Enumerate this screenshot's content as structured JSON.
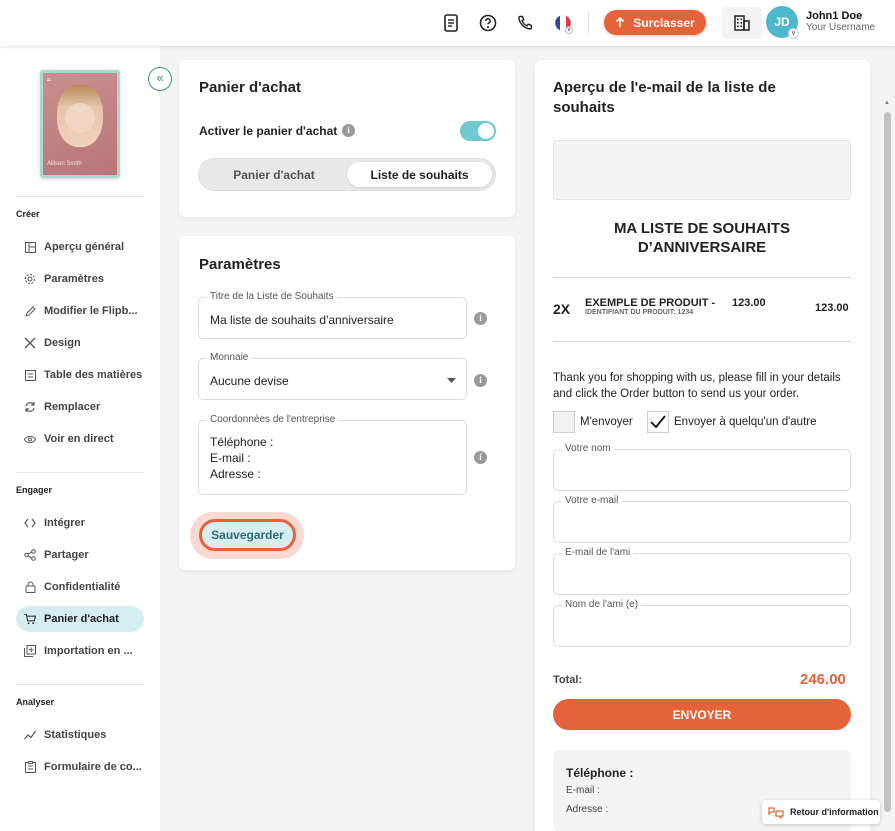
{
  "topbar": {
    "upgrade_label": "Surclasser",
    "avatar_initials": "JD",
    "user_name": "John1 Doe",
    "user_sub": "Your Username"
  },
  "sidebar": {
    "sections": {
      "create": "Créer",
      "engage": "Engager",
      "analyze": "Analyser"
    },
    "create_items": [
      "Aperçu général",
      "Paramètres",
      "Modifier le Flipb...",
      "Design",
      "Table des matières",
      "Remplacer",
      "Voir en direct"
    ],
    "engage_items": [
      "Intégrer",
      "Partager",
      "Confidentialité",
      "Panier d'achat",
      "Importation en ..."
    ],
    "analyze_items": [
      "Statistiques",
      "Formulaire de co..."
    ],
    "cover_text": "Allison Smith"
  },
  "cart_card": {
    "title": "Panier d'achat",
    "enable_label": "Activer le panier d'achat",
    "toggle_on": true,
    "seg_cart": "Panier d'achat",
    "seg_wishlist": "Liste de souhaits"
  },
  "params_card": {
    "title": "Paramètres",
    "wishlist_title_label": "Titre de la Liste de Souhaits",
    "wishlist_title_value": "Ma liste de souhaits d'anniversaire",
    "currency_label": "Monnaie",
    "currency_value": "Aucune devise",
    "company_label": "Coordonnées de l'entreprise",
    "company_lines": [
      "Téléphone :",
      "E-mail :",
      "Adresse :"
    ],
    "save_label": "Sauvegarder"
  },
  "preview": {
    "title": "Aperçu de l'e-mail de la liste de souhaits",
    "wishlist_heading": "MA LISTE DE SOUHAITS D’ANNIVERSAIRE",
    "qty": "2X",
    "product_name": "EXEMPLE DE PRODUIT -",
    "product_price": "123.00",
    "product_id": "IDENTIFIANT DU PRODUIT: 1234",
    "line_total": "123.00",
    "thanks": "Thank you for shopping with us, please fill in your details and click the Order button to send us your order.",
    "send_me": "M'envoyer",
    "send_other": "Envoyer à quelqu'un d'autre",
    "name_label": "Votre nom",
    "email_label": "Votre e-mail",
    "friend_email_label": "E-mail de l'ami",
    "friend_name_label": "Nom de l'ami (e)",
    "total_label": "Total:",
    "total_value": "246.00",
    "send_button": "ENVOYER",
    "contact_phone": "Téléphone :",
    "contact_email": "E-mail :",
    "contact_address": "Adresse :"
  },
  "feedback_label": "Retour d'information",
  "colors": {
    "accent": "#e5623a",
    "teal": "#6ec9d1",
    "active_bg": "#d4eef0"
  }
}
